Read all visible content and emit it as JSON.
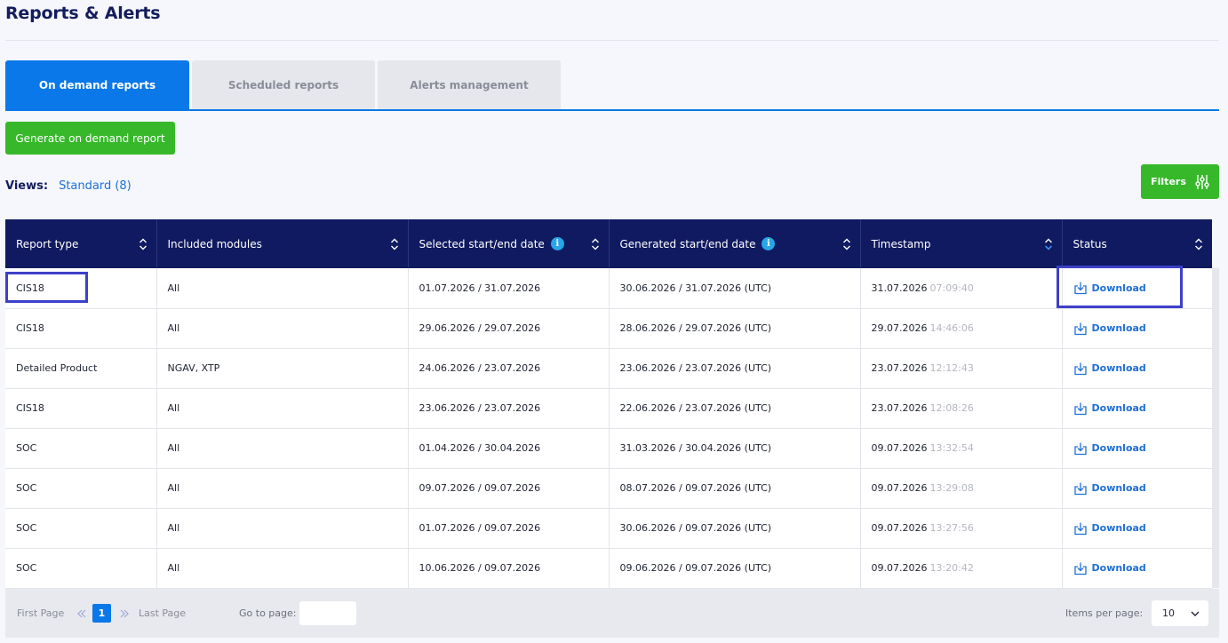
{
  "page": {
    "title": "Reports & Alerts"
  },
  "tabs": [
    {
      "label": "On demand reports",
      "active": true
    },
    {
      "label": "Scheduled reports",
      "active": false
    },
    {
      "label": "Alerts management",
      "active": false
    }
  ],
  "actions": {
    "generate_label": "Generate on demand report",
    "filters_label": "Filters"
  },
  "views": {
    "label": "Views:",
    "value": "Standard (8)"
  },
  "table": {
    "columns": [
      {
        "label": "Report type",
        "info": false
      },
      {
        "label": "Included modules",
        "info": false
      },
      {
        "label": "Selected start/end date",
        "info": true
      },
      {
        "label": "Generated start/end date",
        "info": true
      },
      {
        "label": "Timestamp",
        "info": false
      },
      {
        "label": "Status",
        "info": false
      }
    ],
    "info_glyph": "i",
    "rows": [
      {
        "type": "CIS18",
        "modules": "All",
        "selected": "01.07.2026 / 31.07.2026",
        "generated": "30.06.2026 / 31.07.2026 (UTC)",
        "date": "31.07.2026",
        "time": "07:09:40",
        "status": "Download"
      },
      {
        "type": "CIS18",
        "modules": "All",
        "selected": "29.06.2026 / 29.07.2026",
        "generated": "28.06.2026 / 29.07.2026 (UTC)",
        "date": "29.07.2026",
        "time": "14:46:06",
        "status": "Download"
      },
      {
        "type": "Detailed Product",
        "modules": "NGAV, XTP",
        "selected": "24.06.2026 / 23.07.2026",
        "generated": "23.06.2026 / 23.07.2026 (UTC)",
        "date": "23.07.2026",
        "time": "12:12:43",
        "status": "Download"
      },
      {
        "type": "CIS18",
        "modules": "All",
        "selected": "23.06.2026 / 23.07.2026",
        "generated": "22.06.2026 / 23.07.2026 (UTC)",
        "date": "23.07.2026",
        "time": "12:08:26",
        "status": "Download"
      },
      {
        "type": "SOC",
        "modules": "All",
        "selected": "01.04.2026 / 30.04.2026",
        "generated": "31.03.2026 / 30.04.2026 (UTC)",
        "date": "09.07.2026",
        "time": "13:32:54",
        "status": "Download"
      },
      {
        "type": "SOC",
        "modules": "All",
        "selected": "09.07.2026 / 09.07.2026",
        "generated": "08.07.2026 / 09.07.2026 (UTC)",
        "date": "09.07.2026",
        "time": "13:29:08",
        "status": "Download"
      },
      {
        "type": "SOC",
        "modules": "All",
        "selected": "01.07.2026 / 09.07.2026",
        "generated": "30.06.2026 / 09.07.2026 (UTC)",
        "date": "09.07.2026",
        "time": "13:27:56",
        "status": "Download"
      },
      {
        "type": "SOC",
        "modules": "All",
        "selected": "10.06.2026 / 09.07.2026",
        "generated": "09.06.2026 / 09.07.2026 (UTC)",
        "date": "09.07.2026",
        "time": "13:20:42",
        "status": "Download"
      }
    ]
  },
  "pagination": {
    "first_label": "First Page",
    "last_label": "Last Page",
    "current_page": "1",
    "goto_label": "Go to page:",
    "goto_value": "",
    "items_per_page_label": "Items per page:",
    "items_per_page_value": "10"
  },
  "colors": {
    "accent": "#0a78e8",
    "header": "#0f1a60",
    "green": "#36b82a",
    "link": "#1f6fd6",
    "highlight": "#3d40c9"
  }
}
